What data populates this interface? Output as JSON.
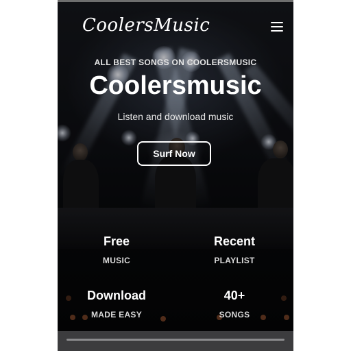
{
  "header": {
    "logo_text": "CoolersMusic",
    "menu_icon": "hamburger-menu-icon"
  },
  "hero": {
    "tagline": "ALL BEST SONGS ON COOLERSMUSIC",
    "title": "Coolersmusic",
    "subtitle": "Listen and download music",
    "cta_label": "Surf Now"
  },
  "stats": [
    {
      "value": "Free",
      "label": "MUSIC"
    },
    {
      "value": "Recent",
      "label": "PLAYLIST"
    },
    {
      "value": "Download",
      "label": "MADE EASY"
    },
    {
      "value": "40+",
      "label": "SONGS"
    }
  ],
  "colors": {
    "background": "#0a0a0c",
    "text": "#ffffff",
    "bottom_bar": "#3c3c3e"
  }
}
